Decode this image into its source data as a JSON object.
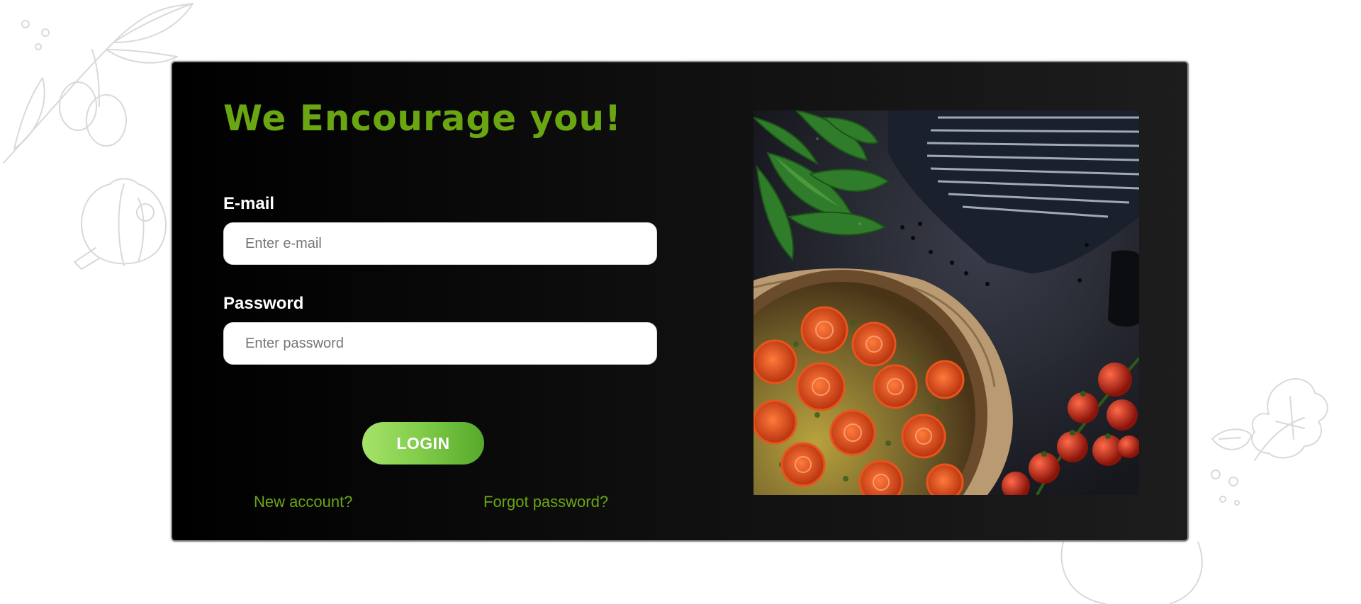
{
  "login": {
    "heading": "We Encourage you!",
    "email_label": "E-mail",
    "email_placeholder": "Enter e-mail",
    "password_label": "Password",
    "password_placeholder": "Enter password",
    "login_button": "LOGIN",
    "new_account_link": "New account?",
    "forgot_password_link": "Forgot password?"
  },
  "image": {
    "subject": "tomato quiche with spinach, cherry tomatoes and striped oven mitt"
  },
  "decorations": [
    "olive-branch-sketch",
    "garlic-sketch",
    "parsley-sketch",
    "mushroom-sketch"
  ],
  "colors": {
    "accent": "#6aa612",
    "button_start": "#a5e36a",
    "button_end": "#57a92b",
    "card_bg_start": "#000000",
    "card_bg_end": "#1d1d1d",
    "card_border": "#8f8f8f"
  }
}
